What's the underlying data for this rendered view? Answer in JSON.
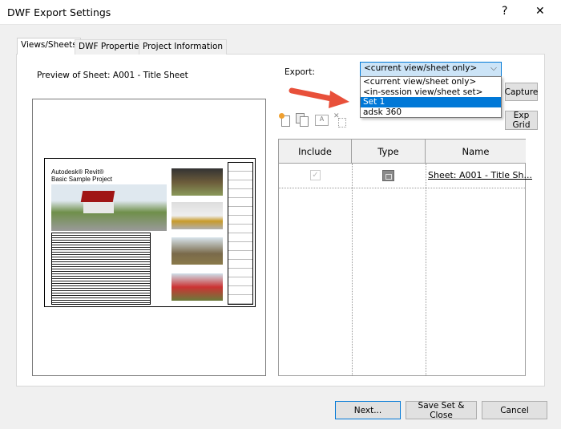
{
  "window": {
    "title": "DWF Export Settings",
    "help": "?",
    "close": "✕"
  },
  "tabs": [
    {
      "label": "Views/Sheets"
    },
    {
      "label": "DWF Properties"
    },
    {
      "label": "Project Information"
    }
  ],
  "preview": {
    "label": "Preview of Sheet: A001 - Title Sheet",
    "sheet_title_line1": "Autodesk® Revit®",
    "sheet_title_line2": "Basic Sample Project"
  },
  "export": {
    "label": "Export:",
    "selected": "<current view/sheet only>",
    "options": [
      "<current view/sheet only>",
      "<in-session view/sheet set>",
      "Set 1",
      "adsk 360"
    ]
  },
  "buttons": {
    "capture": "Capture",
    "exp_grid": "Exp Grid",
    "next": "Next...",
    "save_close": "Save Set & Close",
    "cancel": "Cancel"
  },
  "table": {
    "headers": [
      "Include",
      "Type",
      "Name"
    ],
    "rows": [
      {
        "include": true,
        "type": "sheet-icon",
        "name": "Sheet: A001 - Title Sh..."
      }
    ]
  },
  "colors": {
    "accent": "#0078d7",
    "arrow": "#e8503a"
  }
}
